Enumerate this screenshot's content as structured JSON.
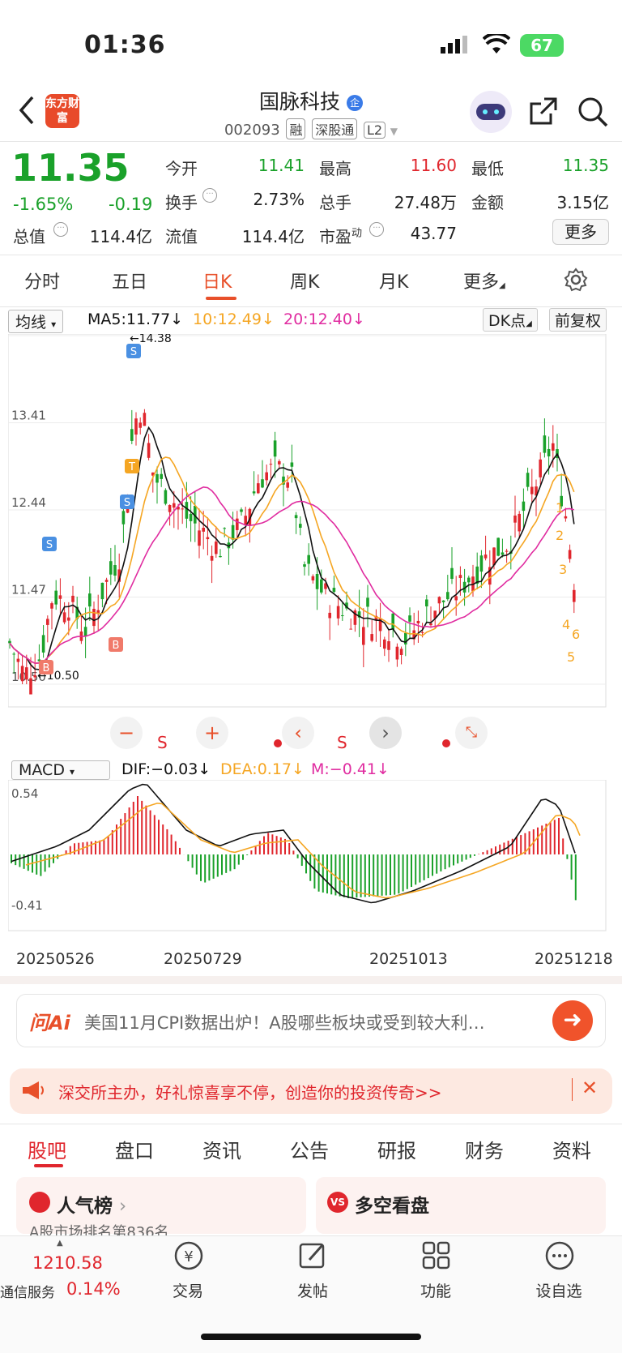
{
  "status": {
    "time": "01:36",
    "battery": "67"
  },
  "header": {
    "title": "国脉科技",
    "title_badge": "企",
    "code": "002093",
    "tags": [
      "融",
      "深股通",
      "L2"
    ],
    "logo": "东方财富"
  },
  "quote": {
    "price": "11.35",
    "change_pct": "-1.65%",
    "change": "-0.19",
    "open_label": "今开",
    "open": "11.41",
    "high_label": "最高",
    "high": "11.60",
    "low_label": "最低",
    "low": "11.35",
    "turnover_label": "换手",
    "turnover": "2.73%",
    "volume_label": "总手",
    "volume": "27.48万",
    "amount_label": "金额",
    "amount": "3.15亿",
    "mcap_label": "总值",
    "mcap": "114.4亿",
    "float_label": "流值",
    "float": "114.4亿",
    "pe_label": "市盈",
    "pe_sup": "动",
    "pe": "43.77",
    "more": "更多"
  },
  "tabs": [
    "分时",
    "五日",
    "日K",
    "周K",
    "月K",
    "更多"
  ],
  "active_tab": "日K",
  "kline": {
    "selector": "均线",
    "ma5": "MA5:11.77↓",
    "ma10": "10:12.49↓",
    "ma20": "20:12.40↓",
    "dk": "DK点",
    "adjust": "前复权",
    "yticks": [
      "14.38",
      "13.41",
      "12.44",
      "11.47",
      "10.50"
    ],
    "max_label": "←14.38",
    "min_label": "←10.50",
    "colors": {
      "up": "#e0262d",
      "down": "#1aa12a",
      "ma5": "#111111",
      "ma10": "#f5a623",
      "ma20": "#e02ca0"
    }
  },
  "macd": {
    "selector": "MACD",
    "dif": "DIF:−0.03↓",
    "dea": "DEA:0.17↓",
    "m": "M:−0.41↓",
    "ytop": "0.54",
    "ybottom": "-0.41",
    "dates": [
      "20250526",
      "20250729",
      "20251013",
      "20251218"
    ]
  },
  "markers": {
    "s_letters": [
      "S",
      "S",
      "S"
    ],
    "b_letters": [
      "B",
      "B"
    ],
    "t_letter": "T",
    "numbers": [
      "1",
      "2",
      "3",
      "4",
      "5",
      "6"
    ],
    "plain_s": [
      "S",
      "S"
    ]
  },
  "ai": {
    "logo": "问Ai",
    "text": "美国11月CPI数据出炉！A股哪些板块或受到较大利…"
  },
  "ad": {
    "text": "深交所主办，好礼惊喜享不停，创造你的投资传奇>>"
  },
  "bottom_tabs": [
    "股吧",
    "盘口",
    "资讯",
    "公告",
    "研报",
    "财务",
    "资料"
  ],
  "cards": {
    "left_title": "人气榜",
    "left_sub": "A股市场排名第836名",
    "right_title": "多空看盘"
  },
  "bottom_bar": {
    "index_value": "1210.58",
    "index_name": "通信服务",
    "index_pct": "0.14%",
    "items": [
      "交易",
      "发帖",
      "功能",
      "设自选"
    ]
  },
  "chart_data": {
    "type": "candlestick",
    "x_start": "20250526",
    "x_end": "20251218",
    "ylim": [
      10.5,
      14.38
    ],
    "ma5_last": 11.77,
    "ma10_last": 12.49,
    "ma20_last": 12.4
  }
}
